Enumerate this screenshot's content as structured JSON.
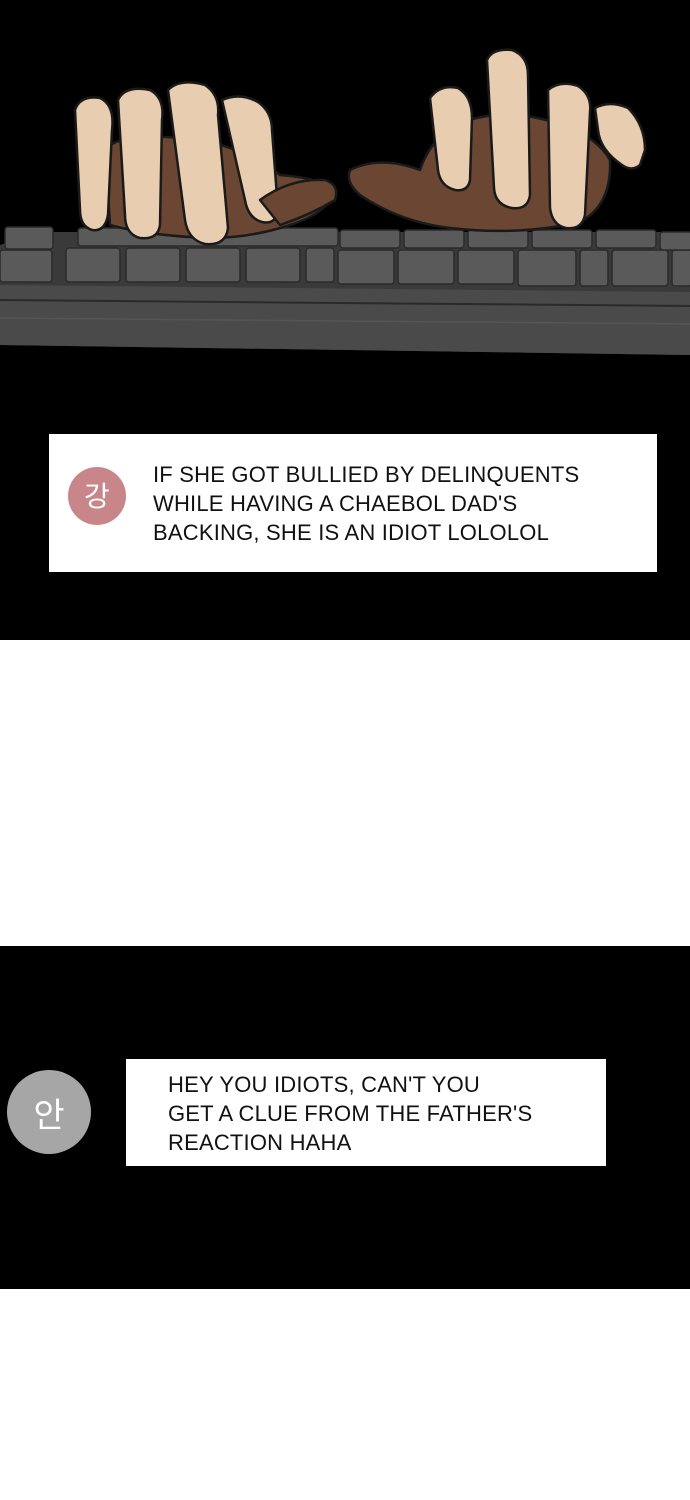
{
  "panels": [
    {
      "scene": "hands-typing-on-keyboard",
      "comment": {
        "avatar_char": "강",
        "avatar_color": "#c9868a",
        "lines": [
          "IF SHE GOT BULLIED BY DELINQUENTS",
          "WHILE HAVING A CHAEBOL DAD'S",
          "BACKING, SHE IS AN IDIOT LOLOLOL"
        ]
      }
    },
    {
      "comment": {
        "avatar_char": "안",
        "avatar_color": "#a6a6a6",
        "lines": [
          "HEY YOU IDIOTS, CAN'T YOU",
          "GET A CLUE FROM THE FATHER'S",
          "REACTION HAHA"
        ]
      }
    }
  ]
}
